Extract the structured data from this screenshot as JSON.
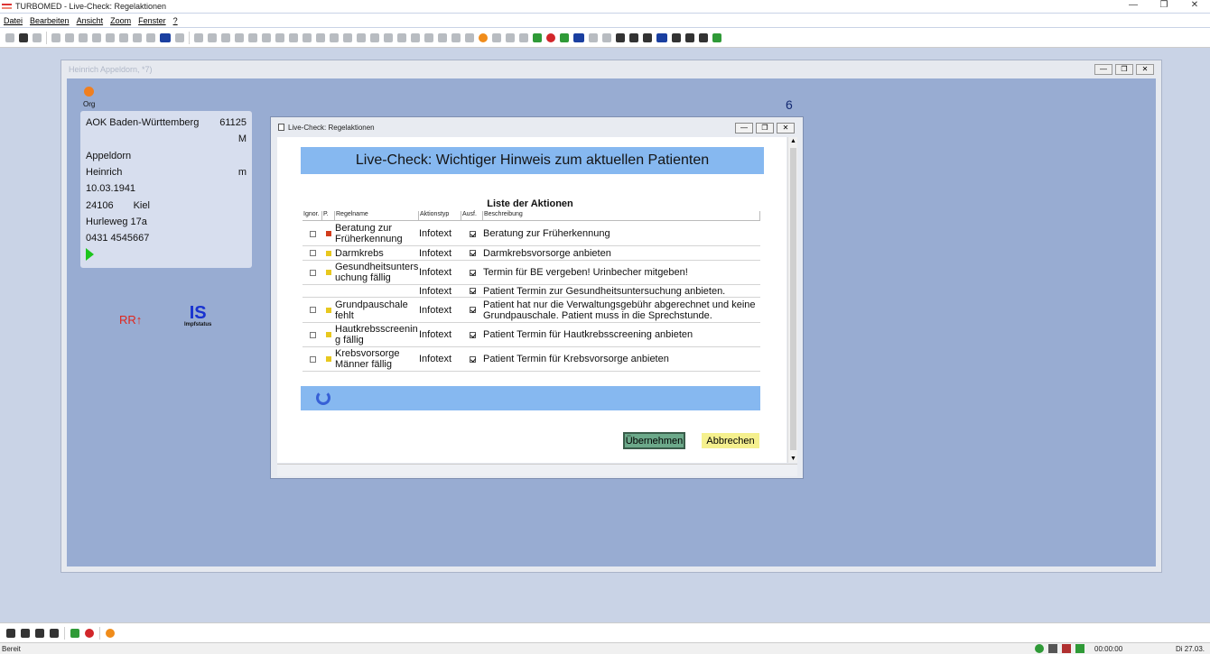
{
  "app": {
    "title": "TURBOMED - Live-Check: Regelaktionen",
    "window_controls": [
      "—",
      "❐",
      "✕"
    ]
  },
  "menu": [
    "Datei",
    "Bearbeiten",
    "Ansicht",
    "Zoom",
    "Fenster",
    "?"
  ],
  "patient_window": {
    "title": "Heinrich Appeldorn, *7)",
    "org_label": "Org",
    "number": "6",
    "card": {
      "insurance": "AOK Baden-Württemberg",
      "insurance_no": "61125",
      "status": "M",
      "last_name": "Appeldorn",
      "first_name": "Heinrich",
      "gender": "m",
      "birthdate": "10.03.1941",
      "zip": "24106",
      "city": "Kiel",
      "street": "Hurleweg 17a",
      "phone": "0431 4545667"
    },
    "rr_label": "RR↑",
    "is_label": "IS",
    "is_sub": "Impfstatus"
  },
  "dialog": {
    "title": "Live-Check: Regelaktionen",
    "heading": "Live-Check: Wichtiger Hinweis zum aktuellen Patienten",
    "list_title": "Liste der Aktionen",
    "columns": [
      "Ignor.",
      "P.",
      "Regelname",
      "Aktionstyp",
      "Ausf.",
      "Beschreibung"
    ],
    "rows": [
      {
        "priority": "red",
        "name": "Beratung zur Früherkennung",
        "type": "Infotext",
        "desc": "Beratung zur Früherkennung"
      },
      {
        "priority": "yellow",
        "name": "Darmkrebs",
        "type": "Infotext",
        "desc": "Darmkrebsvorsorge anbieten"
      },
      {
        "priority": "yellow",
        "name": "Gesundheitsuntersuchung fällig",
        "type": "Infotext",
        "desc": "Termin für BE vergeben! Urinbecher mitgeben!"
      },
      {
        "priority": "",
        "name": "",
        "type": "Infotext",
        "desc": "Patient Termin zur Gesundheitsuntersuchung anbieten."
      },
      {
        "priority": "yellow",
        "name": "Grundpauschale fehlt",
        "type": "Infotext",
        "desc": "Patient hat nur die Verwaltungsgebühr abgerechnet und keine Grundpauschale. Patient muss in die Sprechstunde."
      },
      {
        "priority": "yellow",
        "name": "Hautkrebsscreening fällig",
        "type": "Infotext",
        "desc": "Patient Termin für Hautkrebsscreening anbieten"
      },
      {
        "priority": "yellow",
        "name": "Krebsvorsorge Männer fällig",
        "type": "Infotext",
        "desc": "Patient Termin für Krebsvorsorge anbieten"
      }
    ],
    "ok_label": "Übernehmen",
    "cancel_label": "Abbrechen"
  },
  "status": {
    "ready": "Bereit",
    "time": "00:00:00",
    "date": "Di 27.03."
  }
}
